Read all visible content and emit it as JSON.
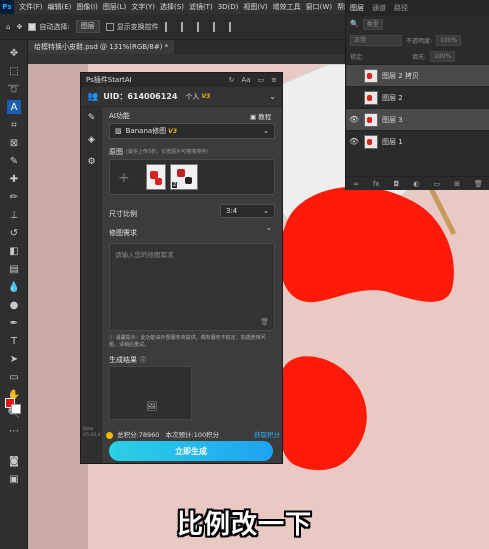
{
  "menubar": {
    "logo": "Ps",
    "items": [
      "文件(F)",
      "编辑(E)",
      "图像(I)",
      "图层(L)",
      "文字(Y)",
      "选择(S)",
      "滤镜(T)",
      "3D(D)",
      "视图(V)",
      "增效工具",
      "窗口(W)",
      "帮助(H)"
    ]
  },
  "options": {
    "auto_select_label": "自动选择:",
    "auto_select_value": "图层",
    "transform_label": "显示变换控件"
  },
  "document": {
    "tab_title": "给模特换小皮鞋.psd @ 131%(RGB/8#) *"
  },
  "layers_panel": {
    "tabs": [
      "图层",
      "通道",
      "路径"
    ],
    "kind_label": "类型",
    "blend_mode": "正常",
    "opacity_label": "不透明度:",
    "opacity_value": "100%",
    "lock_label": "锁定:",
    "fill_label": "填充:",
    "fill_value": "100%",
    "layers": [
      {
        "name": "图层 2 拷贝",
        "visible": false,
        "selected": true
      },
      {
        "name": "图层 2",
        "visible": false,
        "selected": false
      },
      {
        "name": "图层 3",
        "visible": true,
        "selected": true
      },
      {
        "name": "图层 1",
        "visible": true,
        "selected": false
      }
    ],
    "footer_icons": [
      "link-icon",
      "fx-icon",
      "mask-icon",
      "adjustment-icon",
      "group-icon",
      "new-layer-icon",
      "delete-icon"
    ]
  },
  "plugin": {
    "title": "Ps插件StartAI",
    "uid": "UID：614006124",
    "plan": "个人",
    "plan_version": "V3",
    "ai_function_label": "AI功能",
    "tutorial_label": "教程",
    "model_name": "Banana修图",
    "model_version": "V3",
    "original_label": "原图",
    "original_hint": "(最多上传5张，长按图片可拖拽排序)",
    "ratio_label": "尺寸比例",
    "ratio_value": "3:4",
    "request_label": "修图需求",
    "request_placeholder": "请输入您的修图需求",
    "tip_text": "温馨提示：此功能由外部服务商提供，偶有服务不稳定，如遇使用问题，请稍后重试。",
    "result_label": "生成结果",
    "points_label": "总积分:78960",
    "estimate_label": "本次预计:100积分",
    "get_points": "获取积分",
    "generate_button": "立即生成",
    "version_lines": [
      "Beta",
      "V5.20.4"
    ],
    "thumb_badge": "2"
  },
  "subtitle": "比例改一下",
  "colors": {
    "foreground": "#ee1111",
    "background": "#ffffff",
    "accent_start": "#2ad1e3",
    "accent_end": "#1fa2f5",
    "shoe_red": "#ff1a0a"
  }
}
